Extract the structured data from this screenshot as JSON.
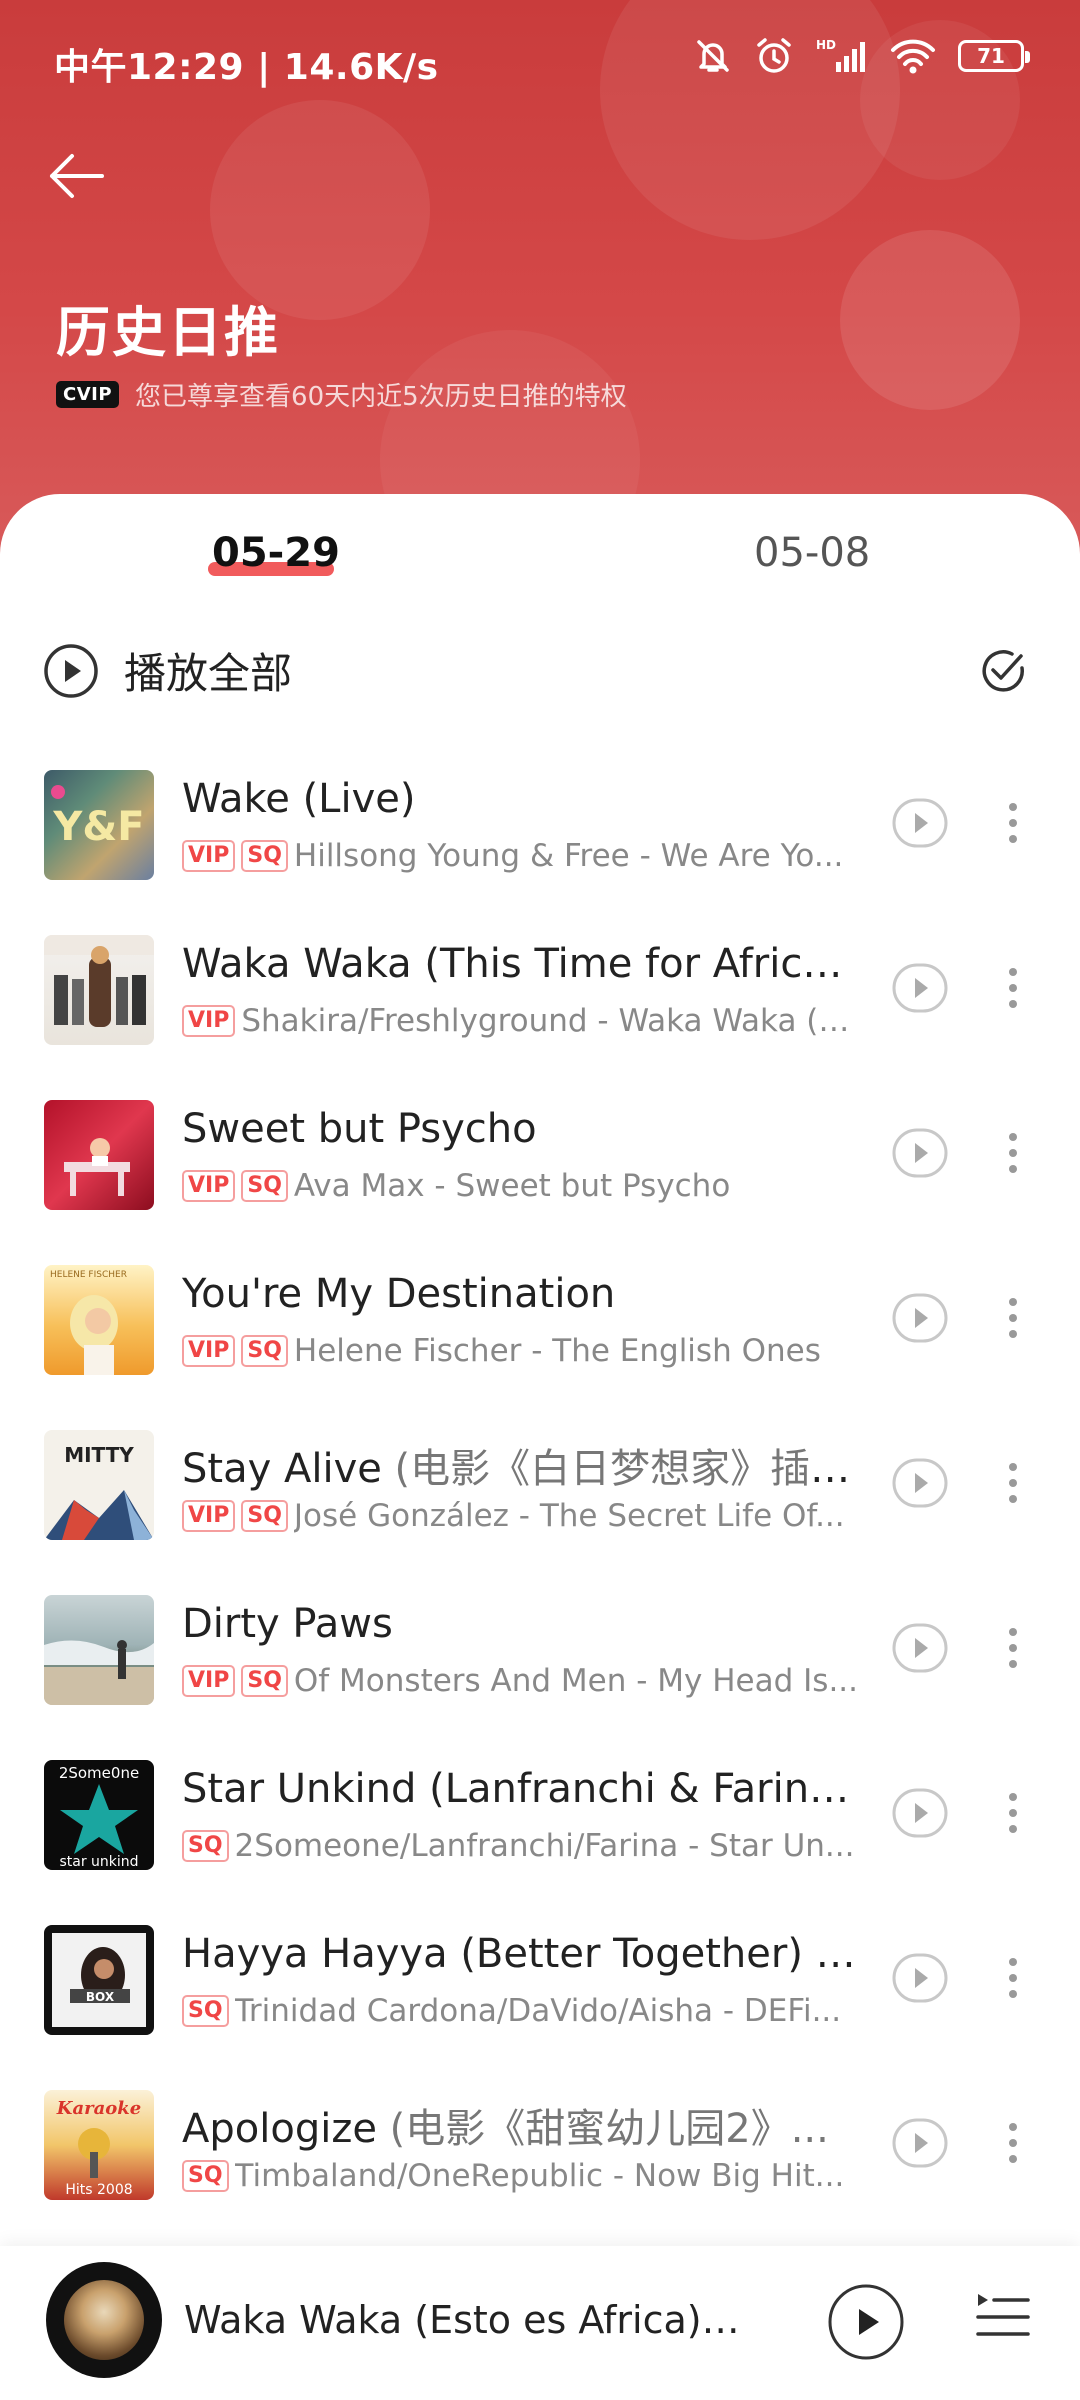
{
  "status_bar": {
    "time_speed": "中午12:29 | 14.6K/s",
    "battery": "71",
    "icons": [
      "mute-bell-icon",
      "alarm-icon",
      "signal-icon",
      "wifi-icon",
      "battery-icon"
    ]
  },
  "header": {
    "title": "历史日推",
    "vip_badge": "CVIP",
    "vip_text": "您已尊享查看60天内近5次历史日推的特权",
    "colors": {
      "header_red": "#c93c3c",
      "accent": "#f0494a"
    }
  },
  "tabs": [
    {
      "label": "05-29",
      "active": true
    },
    {
      "label": "05-08",
      "active": false
    }
  ],
  "play_all": {
    "label": "播放全部"
  },
  "songs": [
    {
      "title": "Wake (Live)",
      "extra": "",
      "artist": "Hillsong Young & Free - We Are Yo...",
      "vip": "VIP",
      "sq": "SQ"
    },
    {
      "title": "Waka Waka (This Time for Africa)...",
      "extra": "",
      "artist": "Shakira/Freshlyground - Waka Waka (T...",
      "vip": "VIP",
      "sq": ""
    },
    {
      "title": "Sweet but Psycho",
      "extra": "",
      "artist": "Ava Max - Sweet but Psycho",
      "vip": "VIP",
      "sq": "SQ"
    },
    {
      "title": "You're My Destination",
      "extra": "",
      "artist": "Helene Fischer - The English Ones",
      "vip": "VIP",
      "sq": "SQ"
    },
    {
      "title": "Stay Alive",
      "extra": " (电影《白日梦想家》插曲)",
      "artist": "José González - The Secret Life Of...",
      "vip": "VIP",
      "sq": "SQ"
    },
    {
      "title": "Dirty Paws",
      "extra": "",
      "artist": "Of Monsters And Men - My Head Is...",
      "vip": "VIP",
      "sq": "SQ"
    },
    {
      "title": "Star Unkind (Lanfranchi & Farina...",
      "extra": "",
      "artist": "2Someone/Lanfranchi/Farina - Star Un...",
      "vip": "",
      "sq": "SQ"
    },
    {
      "title": "Hayya Hayya (Better Together) (...",
      "extra": "",
      "artist": "Trinidad Cardona/DaVido/Aisha - DEFi...",
      "vip": "",
      "sq": "SQ"
    },
    {
      "title": "Apologize",
      "extra": " (电影《甜蜜幼儿园2》...",
      "artist": "Timbaland/OneRepublic - Now Big Hit...",
      "vip": "",
      "sq": "SQ"
    }
  ],
  "covers": {
    "yf": "Y&F",
    "mitty": "MITTY",
    "star": "2Some0ne",
    "star_sub": "star unkind",
    "karaoke": "Karaoke",
    "hits": "Hits 2008",
    "helene": "HELENE FISCHER"
  },
  "mini_player": {
    "title": "Waka Waka (Esto es Africa) (..."
  }
}
